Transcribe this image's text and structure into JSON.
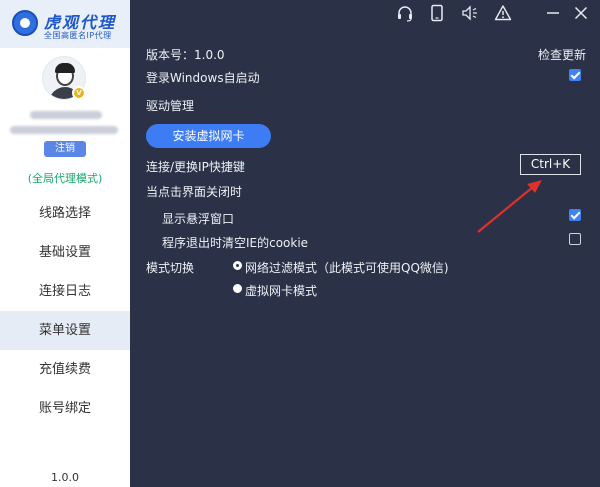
{
  "sidebar": {
    "logo_title": "虎观代理",
    "logo_subtitle": "全国高匿名IP代理",
    "logout_label": "注销",
    "mode_label": "(全局代理模式)",
    "vip_badge": "V",
    "items": [
      {
        "label": "线路选择"
      },
      {
        "label": "基础设置"
      },
      {
        "label": "连接日志"
      },
      {
        "label": "菜单设置",
        "active": true
      },
      {
        "label": "充值续费"
      },
      {
        "label": "账号绑定"
      }
    ],
    "version": "1.0.0"
  },
  "topbar": {
    "icons": [
      "headset-icon",
      "tablet-icon",
      "speaker-icon",
      "warning-icon",
      "minimize-icon",
      "close-icon"
    ]
  },
  "settings": {
    "version_label": "版本号：1.0.0",
    "check_update": "检查更新",
    "autostart_label": "登录Windows自启动",
    "autostart_checked": true,
    "driver_label": "驱动管理",
    "install_button": "安装虚拟网卡",
    "hotkey_label": "连接/更换IP快捷键",
    "hotkey_value": "Ctrl+K",
    "on_close_label": "当点击界面关闭时",
    "show_float_label": "显示悬浮窗口",
    "show_float_checked": true,
    "clear_cookie_label": "程序退出时清空IE的cookie",
    "clear_cookie_checked": false,
    "mode_switch_label": "模式切换",
    "mode_options": [
      {
        "label": "网络过滤模式（此模式可使用QQ微信)",
        "selected": true
      },
      {
        "label": "虚拟网卡模式",
        "selected": false
      }
    ]
  },
  "colors": {
    "main_bg": "#2b3146",
    "accent": "#3d7cf2",
    "sidebar_active": "#e6ecf5",
    "mode_green": "#1aa86a",
    "annotation_arrow": "#e0302a"
  }
}
